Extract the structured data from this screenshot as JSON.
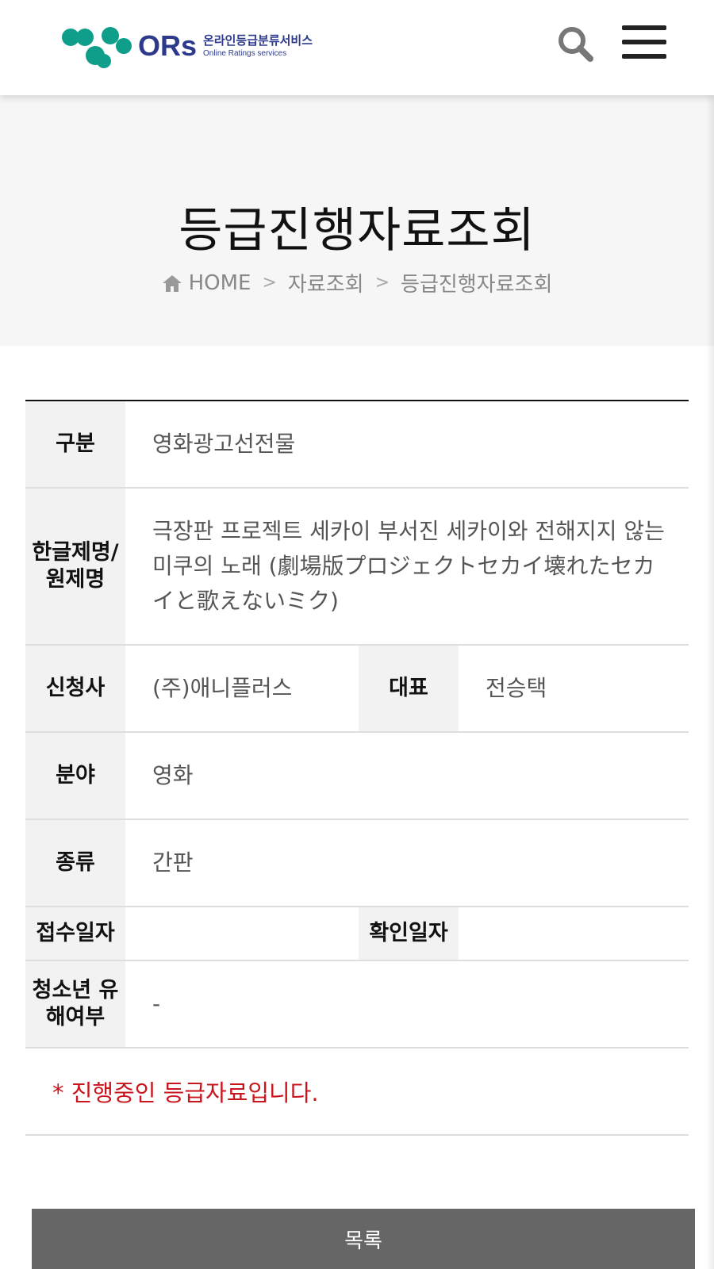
{
  "header": {
    "logo_ors": "ORs",
    "logo_kor": "온라인등급분류서비스",
    "logo_eng": "Online Ratings services",
    "search_icon": "search-icon",
    "menu_icon": "hamburger-menu-icon"
  },
  "hero": {
    "title": "등급진행자료조회",
    "breadcrumb": [
      "HOME",
      "자료조회",
      "등급진행자료조회"
    ],
    "breadcrumb_sep": ">"
  },
  "info": {
    "category_label": "구분",
    "category_value": "영화광고선전물",
    "title_label": "한글제명/\n원제명",
    "title_value": "극장판 프로젝트 세카이 부서진 세카이와 전해지지 않는 미쿠의 노래 (劇場版プロジェクトセカイ壊れたセカイと歌えないミク)",
    "applicant_label": "신청사",
    "applicant_value": "(주)애니플러스",
    "rep_label": "대표",
    "rep_value": "전승택",
    "field_label": "분야",
    "field_value": "영화",
    "type_label": "종류",
    "type_value": "간판",
    "received_label": "접수일자",
    "received_value": "",
    "confirmed_label": "확인일자",
    "confirmed_value": "",
    "youth_label": "청소년 유\n해여부",
    "youth_value": "-",
    "notice": "* 진행중인 등급자료입니다."
  },
  "actions": {
    "list_label": "목록"
  },
  "colors": {
    "brand_green": "#0e9e8a",
    "brand_navy": "#2d3a8c",
    "notice_red": "#c8161d",
    "button_gray": "#666666"
  }
}
